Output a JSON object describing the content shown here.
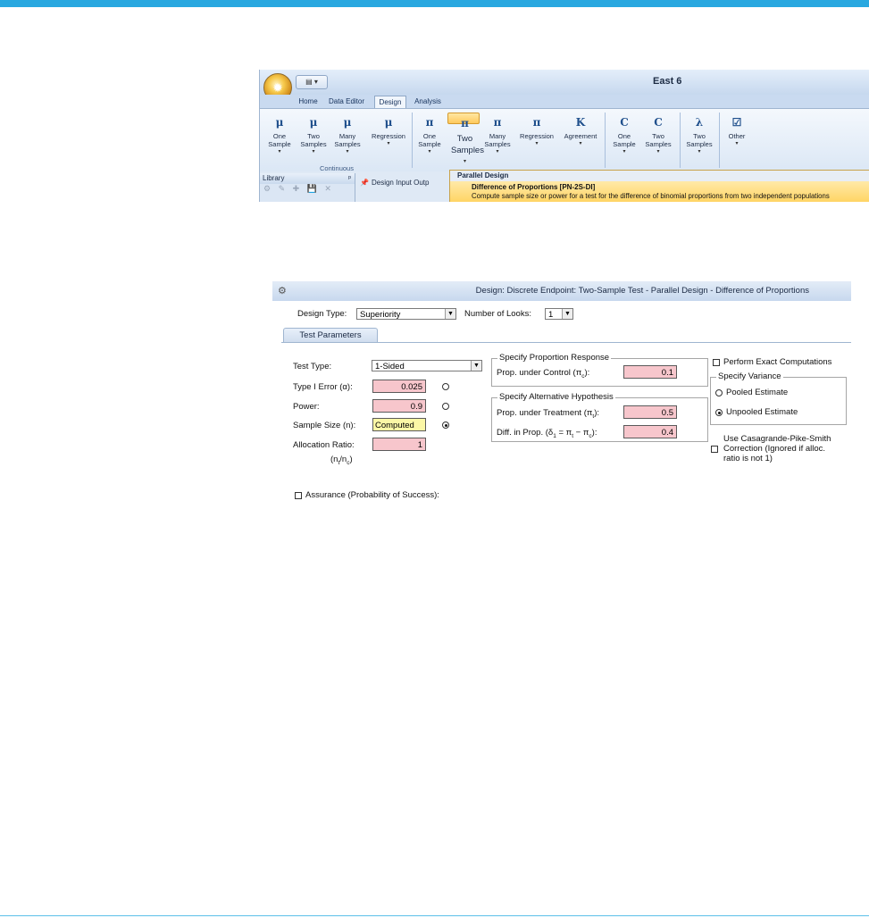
{
  "ribbon": {
    "app_title": "East 6",
    "tabs": [
      "Home",
      "Data Editor",
      "Design",
      "Analysis"
    ],
    "groups": {
      "continuous_label": "Continuous"
    },
    "buttons": [
      {
        "icon": "μ",
        "label": "One Sample"
      },
      {
        "icon": "μ",
        "label": "Two Samples"
      },
      {
        "icon": "μ",
        "label": "Many Samples"
      },
      {
        "icon": "μ",
        "label": "Regression"
      },
      {
        "icon": "π",
        "label": "One Sample"
      },
      {
        "icon": "π",
        "label": "Two Samples"
      },
      {
        "icon": "π",
        "label": "Many Samples"
      },
      {
        "icon": "π",
        "label": "Regression"
      },
      {
        "icon": "K",
        "label": "Agreement"
      },
      {
        "icon": "C",
        "label": "One Sample"
      },
      {
        "icon": "C",
        "label": "Two Samples"
      },
      {
        "icon": "λ",
        "label": "Two Samples"
      },
      {
        "icon": "☑",
        "label": "Other"
      }
    ],
    "library_label": "Library",
    "design_input_output": "Design Input Outp",
    "dropdown": {
      "header": "Parallel Design",
      "item_title": "Difference of Proportions [PN-2S-DI]",
      "item_desc": "Compute sample size or power for a test for the difference of binomial proportions from two independent populations"
    }
  },
  "dialog": {
    "title": "Design: Discrete Endpoint: Two-Sample Test - Parallel Design - Difference of Proportions",
    "design_type_label": "Design Type:",
    "design_type_value": "Superiority",
    "num_looks_label": "Number of Looks:",
    "num_looks_value": "1",
    "tab": "Test Parameters",
    "test_type_label": "Test Type:",
    "test_type_value": "1-Sided",
    "type1_label": "Type I Error (α):",
    "type1_value": "0.025",
    "power_label": "Power:",
    "power_value": "0.9",
    "sample_size_label": "Sample Size (n):",
    "sample_size_value": "Computed",
    "alloc_label": "Allocation Ratio:",
    "alloc_value": "1",
    "alloc_sub": "(n",
    "prop_response_legend": "Specify Proportion Response",
    "prop_control_label": "Prop. under Control (π",
    "prop_control_value": "0.1",
    "alt_hyp_legend": "Specify Alternative Hypothesis",
    "prop_treatment_label": "Prop. under Treatment (π",
    "prop_treatment_value": "0.5",
    "diff_label": "Diff. in Prop. (δ",
    "diff_value": "0.4",
    "exact_label": "Perform Exact Computations",
    "variance_legend": "Specify Variance",
    "pooled_label": "Pooled Estimate",
    "unpooled_label": "Unpooled Estimate",
    "casagrande_line1": "Use Casagrande-Pike-Smith",
    "casagrande_line2": "Correction (Ignored if alloc.",
    "casagrande_line3": "ratio is not 1)",
    "assurance_label": "Assurance (Probability of Success):"
  }
}
